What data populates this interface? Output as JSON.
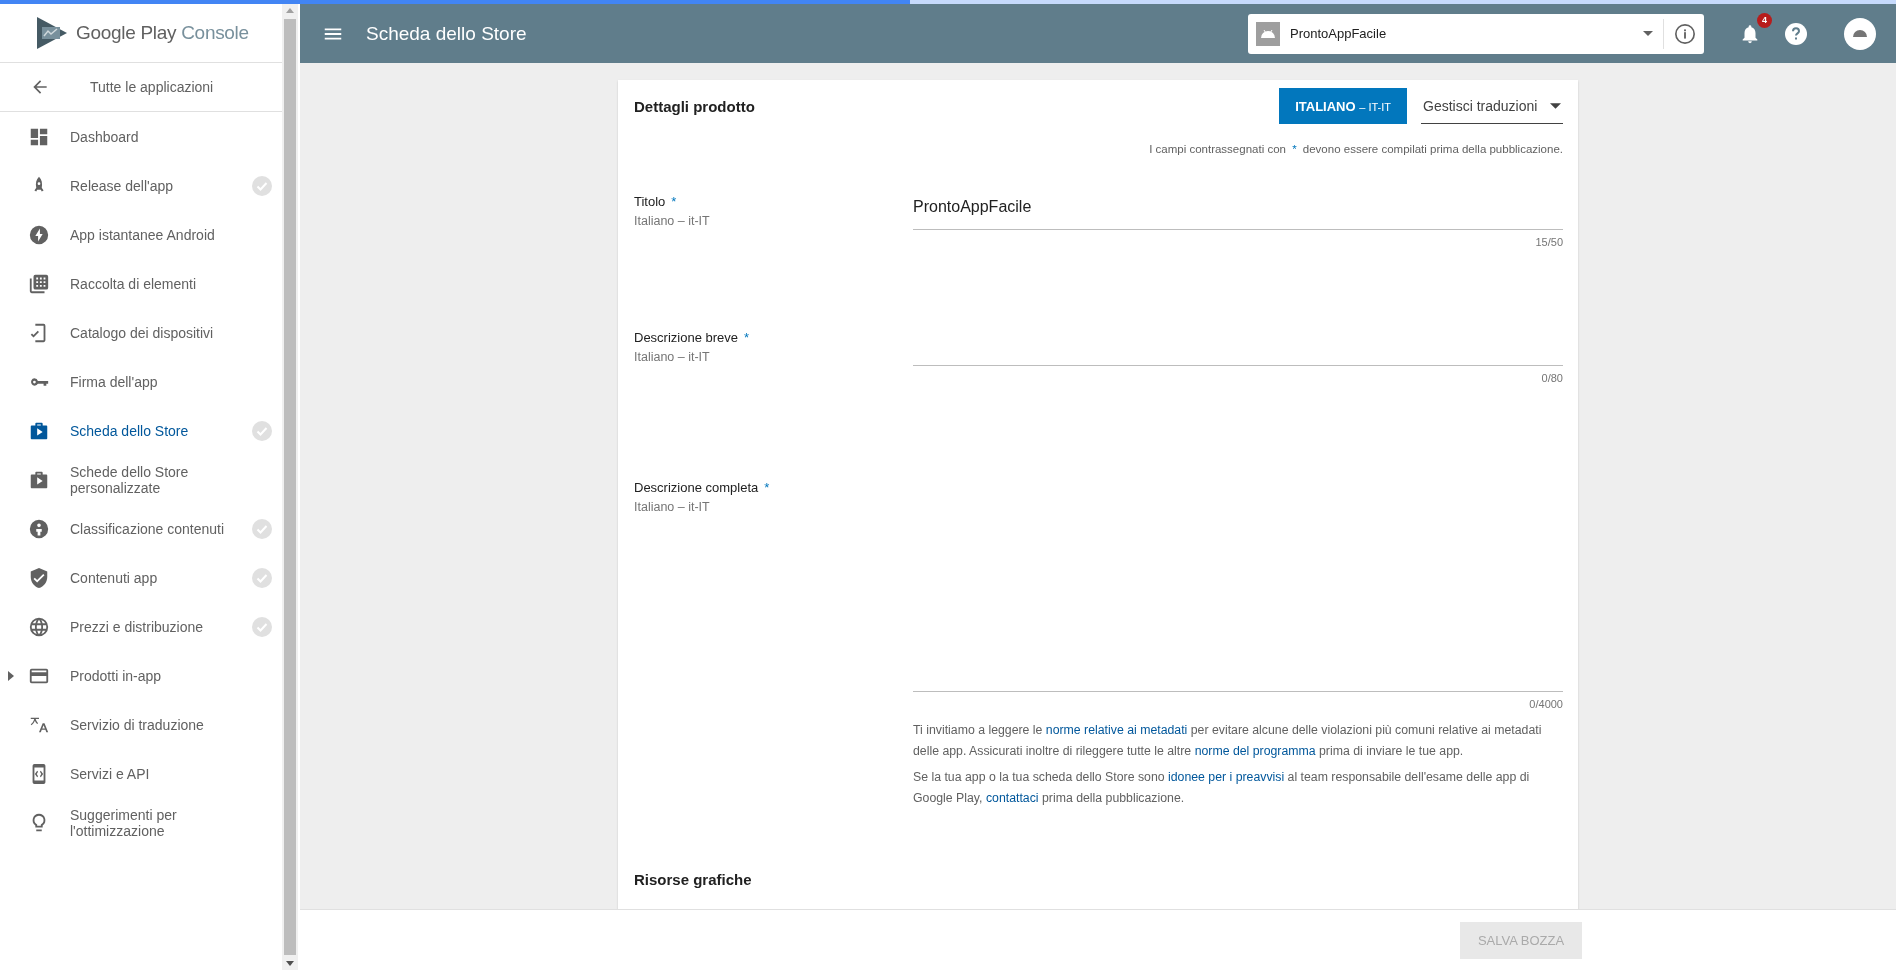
{
  "top_progress": {
    "level": 0.48
  },
  "sidebar": {
    "logo": {
      "brand": "Google Play",
      "product": "Console"
    },
    "back_link": "Tutte le applicazioni",
    "items": [
      {
        "label": "Dashboard",
        "selected": false,
        "done": false,
        "expandable": false
      },
      {
        "label": "Release dell'app",
        "selected": false,
        "done": true,
        "expandable": false
      },
      {
        "label": "App istantanee Android",
        "selected": false,
        "done": false,
        "expandable": false
      },
      {
        "label": "Raccolta di elementi",
        "selected": false,
        "done": false,
        "expandable": false
      },
      {
        "label": "Catalogo dei dispositivi",
        "selected": false,
        "done": false,
        "expandable": false
      },
      {
        "label": "Firma dell'app",
        "selected": false,
        "done": false,
        "expandable": false
      },
      {
        "label": "Scheda dello Store",
        "selected": true,
        "done": true,
        "expandable": false
      },
      {
        "label": "Schede dello Store personalizzate",
        "selected": false,
        "done": false,
        "expandable": false
      },
      {
        "label": "Classificazione contenuti",
        "selected": false,
        "done": true,
        "expandable": false
      },
      {
        "label": "Contenuti app",
        "selected": false,
        "done": true,
        "expandable": false
      },
      {
        "label": "Prezzi e distribuzione",
        "selected": false,
        "done": true,
        "expandable": false
      },
      {
        "label": "Prodotti in-app",
        "selected": false,
        "done": false,
        "expandable": true
      },
      {
        "label": "Servizio di traduzione",
        "selected": false,
        "done": false,
        "expandable": false
      },
      {
        "label": "Servizi e API",
        "selected": false,
        "done": false,
        "expandable": false
      },
      {
        "label": "Suggerimenti per l'ottimizzazione",
        "selected": false,
        "done": false,
        "expandable": false
      }
    ]
  },
  "header": {
    "title": "Scheda dello Store",
    "app_selector": {
      "value": "ProntoAppFacile"
    },
    "notifications_badge": "4"
  },
  "card": {
    "title": "Dettagli prodotto",
    "language_button": {
      "label": "ITALIANO",
      "sublabel": "– IT-IT"
    },
    "translations_dropdown": "Gestisci traduzioni",
    "notice": [
      {
        "text": "I campi contrassegnati con ",
        "mark": false
      },
      {
        "text": "*",
        "mark": true
      },
      {
        "text": " devono essere compilati prima della pubblicazione.",
        "mark": false
      }
    ],
    "fields": [
      {
        "kind": "input",
        "label": "Titolo",
        "required_mark": "*",
        "language": "Italiano – it-IT",
        "value": "ProntoAppFacile",
        "counter": "15/50"
      },
      {
        "kind": "input",
        "label": "Descrizione breve",
        "required_mark": "*",
        "language": "Italiano – it-IT",
        "counter": "0/80"
      },
      {
        "kind": "textarea",
        "label": "Descrizione completa",
        "required_mark": "*",
        "language": "Italiano – it-IT",
        "counter": "0/4000"
      }
    ],
    "paragraphs": [
      [
        {
          "text": "Ti invitiamo a leggere le ",
          "link": false
        },
        {
          "text": "norme relative ai metadati",
          "link": true
        },
        {
          "text": " per evitare alcune delle violazioni più comuni relative ai metadati delle app. Assicurati inoltre di rileggere tutte le altre ",
          "link": false
        },
        {
          "text": "norme del programma",
          "link": true
        },
        {
          "text": " prima di inviare le tue app.",
          "link": false
        }
      ],
      [
        {
          "text": "Se la tua app o la tua scheda dello Store sono ",
          "link": false
        },
        {
          "text": "idonee per i preavvisi",
          "link": true
        },
        {
          "text": " al team responsabile dell'esame delle app di Google Play, ",
          "link": false
        },
        {
          "text": "contattaci",
          "link": true
        },
        {
          "text": " prima della pubblicazione.",
          "link": false
        }
      ]
    ],
    "section_title": "Risorse grafiche"
  },
  "footer": {
    "save_button": {
      "label": "SALVA BOZZA",
      "disabled": true
    }
  }
}
